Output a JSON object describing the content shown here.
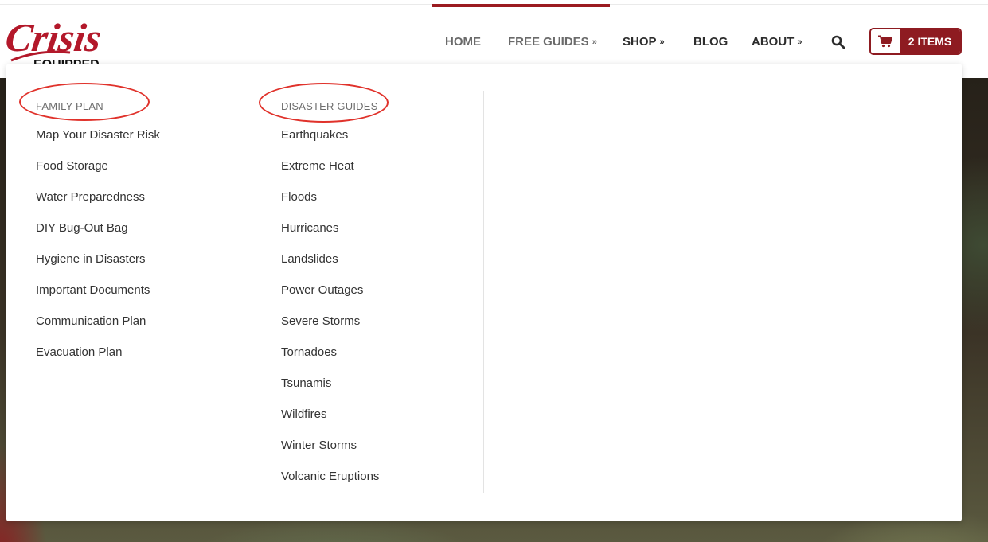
{
  "logo": {
    "alt": "Crisis Equipped"
  },
  "nav": {
    "items": [
      {
        "label": "HOME",
        "has_dropdown": false
      },
      {
        "label": "FREE GUIDES",
        "has_dropdown": true
      },
      {
        "label": "SHOP",
        "has_dropdown": true
      },
      {
        "label": "BLOG",
        "has_dropdown": false
      },
      {
        "label": "ABOUT",
        "has_dropdown": true
      }
    ],
    "search_icon": "search-icon"
  },
  "cart": {
    "label": "2 ITEMS",
    "icon": "cart-icon"
  },
  "menu": {
    "family_plan": {
      "heading": "FAMILY PLAN",
      "links": [
        "Map Your Disaster Risk",
        "Food Storage",
        "Water Preparedness",
        "DIY Bug-Out Bag",
        "Hygiene in Disasters",
        "Important Documents",
        "Communication Plan",
        "Evacuation Plan"
      ]
    },
    "disaster_guides": {
      "heading": "DISASTER GUIDES",
      "links": [
        "Earthquakes",
        "Extreme Heat",
        "Floods",
        "Hurricanes",
        "Landslides",
        "Power Outages",
        "Severe Storms",
        "Tornadoes",
        "Tsunamis",
        "Wildfires",
        "Winter Storms",
        "Volcanic Eruptions"
      ]
    }
  },
  "colors": {
    "brand_red": "#9b1b20",
    "annotation_red": "#e0322b"
  }
}
